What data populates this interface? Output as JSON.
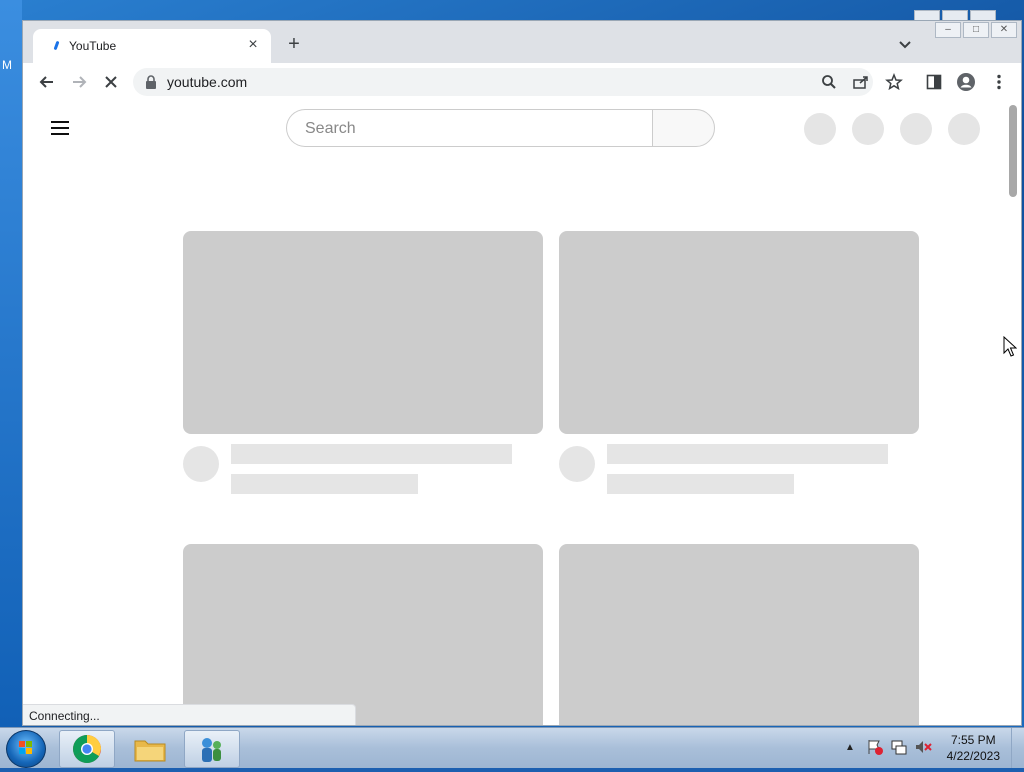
{
  "desktop": {
    "edge_text": "M"
  },
  "browser": {
    "tab": {
      "title": "YouTube",
      "close_label": "×"
    },
    "new_tab_label": "+",
    "url": "youtube.com",
    "window_controls": {
      "minimize": "–",
      "maximize": "□",
      "close": "✕"
    }
  },
  "youtube": {
    "search": {
      "placeholder": "Search",
      "value": ""
    }
  },
  "status": {
    "text": "Connecting..."
  },
  "taskbar": {
    "apps": [
      "chrome-icon",
      "file-explorer-icon",
      "network-users-icon"
    ],
    "clock": {
      "time": "7:55 PM",
      "date": "4/22/2023"
    }
  },
  "colors": {
    "placeholder_thumb": "#cccccc",
    "placeholder_light": "#e5e5e5",
    "chrome_bar": "#dee1e6"
  }
}
